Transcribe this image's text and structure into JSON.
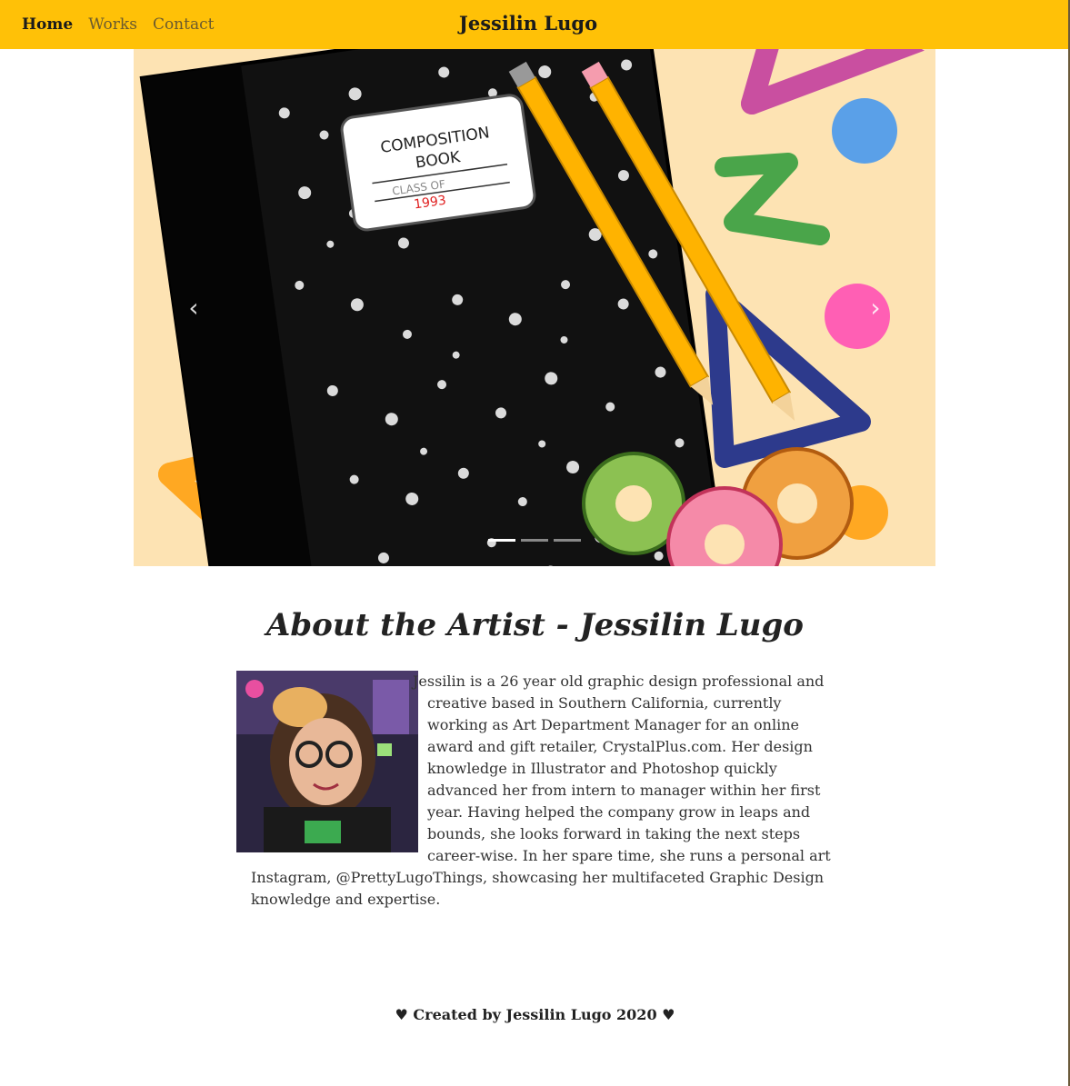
{
  "nav": {
    "home": "Home",
    "works": "Works",
    "contact": "Contact",
    "brand": "Jessilin Lugo"
  },
  "carousel": {
    "prev_icon": "chevron-left-icon",
    "next_icon": "chevron-right-icon",
    "prev_glyph": "‹",
    "next_glyph": "›",
    "slide_count": 3,
    "active_slide": 1,
    "notebook": {
      "line1": "COMPOSITION",
      "line2": "BOOK",
      "line3": "CLASS OF",
      "line4": "1993"
    }
  },
  "about": {
    "title": "About the Artist - Jessilin Lugo",
    "text": "Jessilin is a 26 year old graphic design professional and creative based in Southern California, currently working as Art Department Manager for an online award and gift retailer, CrystalPlus.com. Her design knowledge in Illustrator and Photoshop quickly advanced her from intern to manager within her first year. Having helped the company grow in leaps and bounds, she looks forward in taking the next steps career-wise. In her spare time, she runs a personal art Instagram, @PrettyLugoThings, showcasing her multifaceted Graphic Design knowledge and expertise."
  },
  "footer": {
    "text": "♥ Created by Jessilin Lugo 2020 ♥"
  },
  "colors": {
    "navbar": "#ffc107",
    "slide_background": "#fde3b3"
  }
}
